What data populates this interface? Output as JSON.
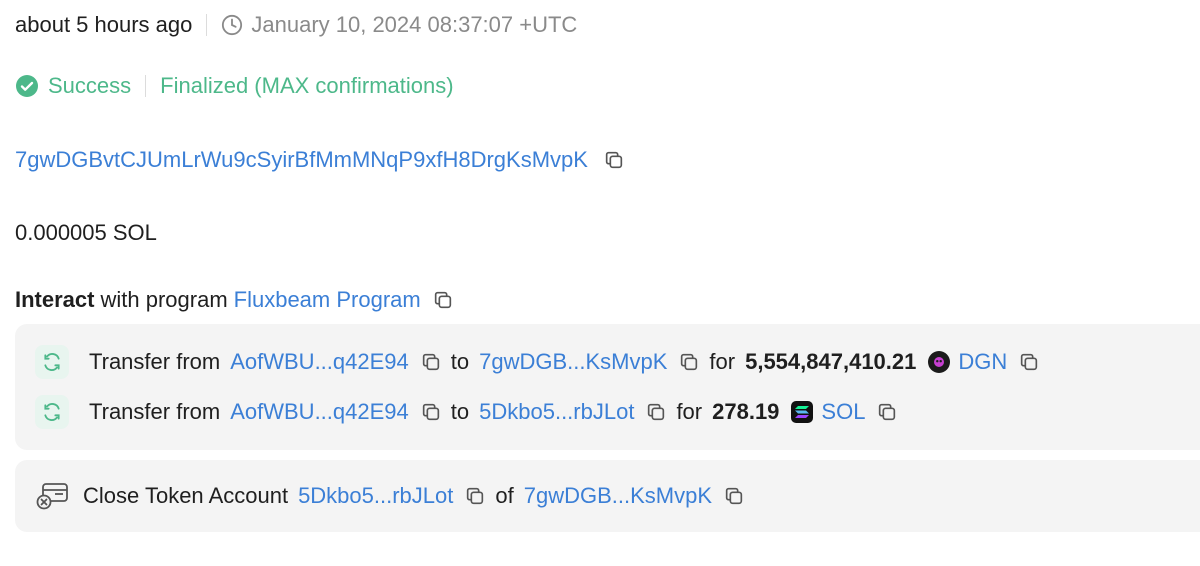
{
  "time": {
    "relative": "about 5 hours ago",
    "absolute": "January 10, 2024 08:37:07 +UTC"
  },
  "status": {
    "result": "Success",
    "confirmation": "Finalized (MAX confirmations)"
  },
  "signer": "7gwDGBvtCJUmLrWu9cSyirBfMmMNqP9xfH8DrgKsMvpK",
  "fee": "0.000005 SOL",
  "interact": {
    "prefix": "Interact",
    "middle": "with program",
    "program": "Fluxbeam Program"
  },
  "transfers": [
    {
      "action": "Transfer from",
      "from": "AofWBU...q42E94",
      "to_word": "to",
      "to": "7gwDGB...KsMvpK",
      "for_word": "for",
      "amount": "5,554,847,410.21",
      "token": "DGN"
    },
    {
      "action": "Transfer from",
      "from": "AofWBU...q42E94",
      "to_word": "to",
      "to": "5Dkbo5...rbJLot",
      "for_word": "for",
      "amount": "278.19",
      "token": "SOL"
    }
  ],
  "close_account": {
    "action": "Close Token Account",
    "account": "5Dkbo5...rbJLot",
    "of_word": "of",
    "owner": "7gwDGB...KsMvpK"
  },
  "colors": {
    "link": "#3b7fd6",
    "success": "#4db88a",
    "muted": "#8a8a8a",
    "panel_bg": "#f4f4f4"
  },
  "icons": {
    "clock": "clock-icon",
    "success": "check-circle-icon",
    "copy": "copy-icon",
    "transfer": "refresh-arrows-icon",
    "dgn": "dgn-token-icon",
    "sol": "sol-token-icon",
    "close": "close-account-icon"
  }
}
